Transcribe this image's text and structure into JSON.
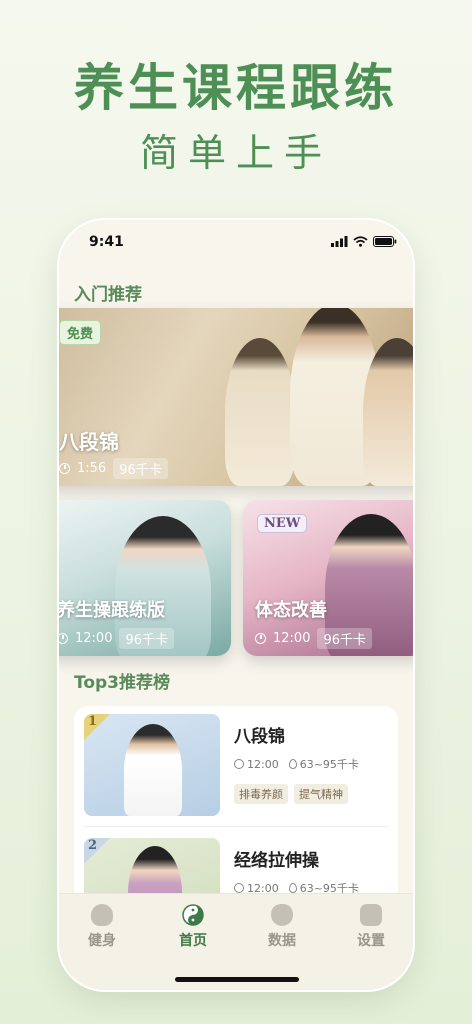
{
  "hero": {
    "title": "养生课程跟练",
    "subtitle": "简单上手"
  },
  "status_bar": {
    "time": "9:41"
  },
  "intro": {
    "section_title": "入门推荐",
    "featured": {
      "badge": "免费",
      "title": "八段锦",
      "duration": "1:56",
      "kcal": "96千卡"
    },
    "cards": [
      {
        "title": "养生操跟练版",
        "duration": "12:00",
        "kcal": "96千卡"
      },
      {
        "badge": "NEW",
        "title": "体态改善",
        "duration": "12:00",
        "kcal": "96千卡"
      }
    ]
  },
  "top3": {
    "section_title": "Top3推荐榜",
    "items": [
      {
        "rank": "1",
        "title": "八段锦",
        "duration": "12:00",
        "kcal": "63~95千卡",
        "tags": [
          "排毒养颜",
          "提气精神"
        ]
      },
      {
        "rank": "2",
        "title": "经络拉伸操",
        "duration": "12:00",
        "kcal": "63~95千卡",
        "tags": []
      }
    ]
  },
  "tabbar": {
    "items": [
      {
        "label": "健身",
        "icon": "meditation-icon"
      },
      {
        "label": "首页",
        "icon": "yin-yang-icon"
      },
      {
        "label": "数据",
        "icon": "gourd-icon"
      },
      {
        "label": "设置",
        "icon": "gear-icon"
      }
    ]
  },
  "colors": {
    "accent": "#4e8f55",
    "active_tab": "#3e7a48",
    "section_title": "#5a8a5a"
  }
}
